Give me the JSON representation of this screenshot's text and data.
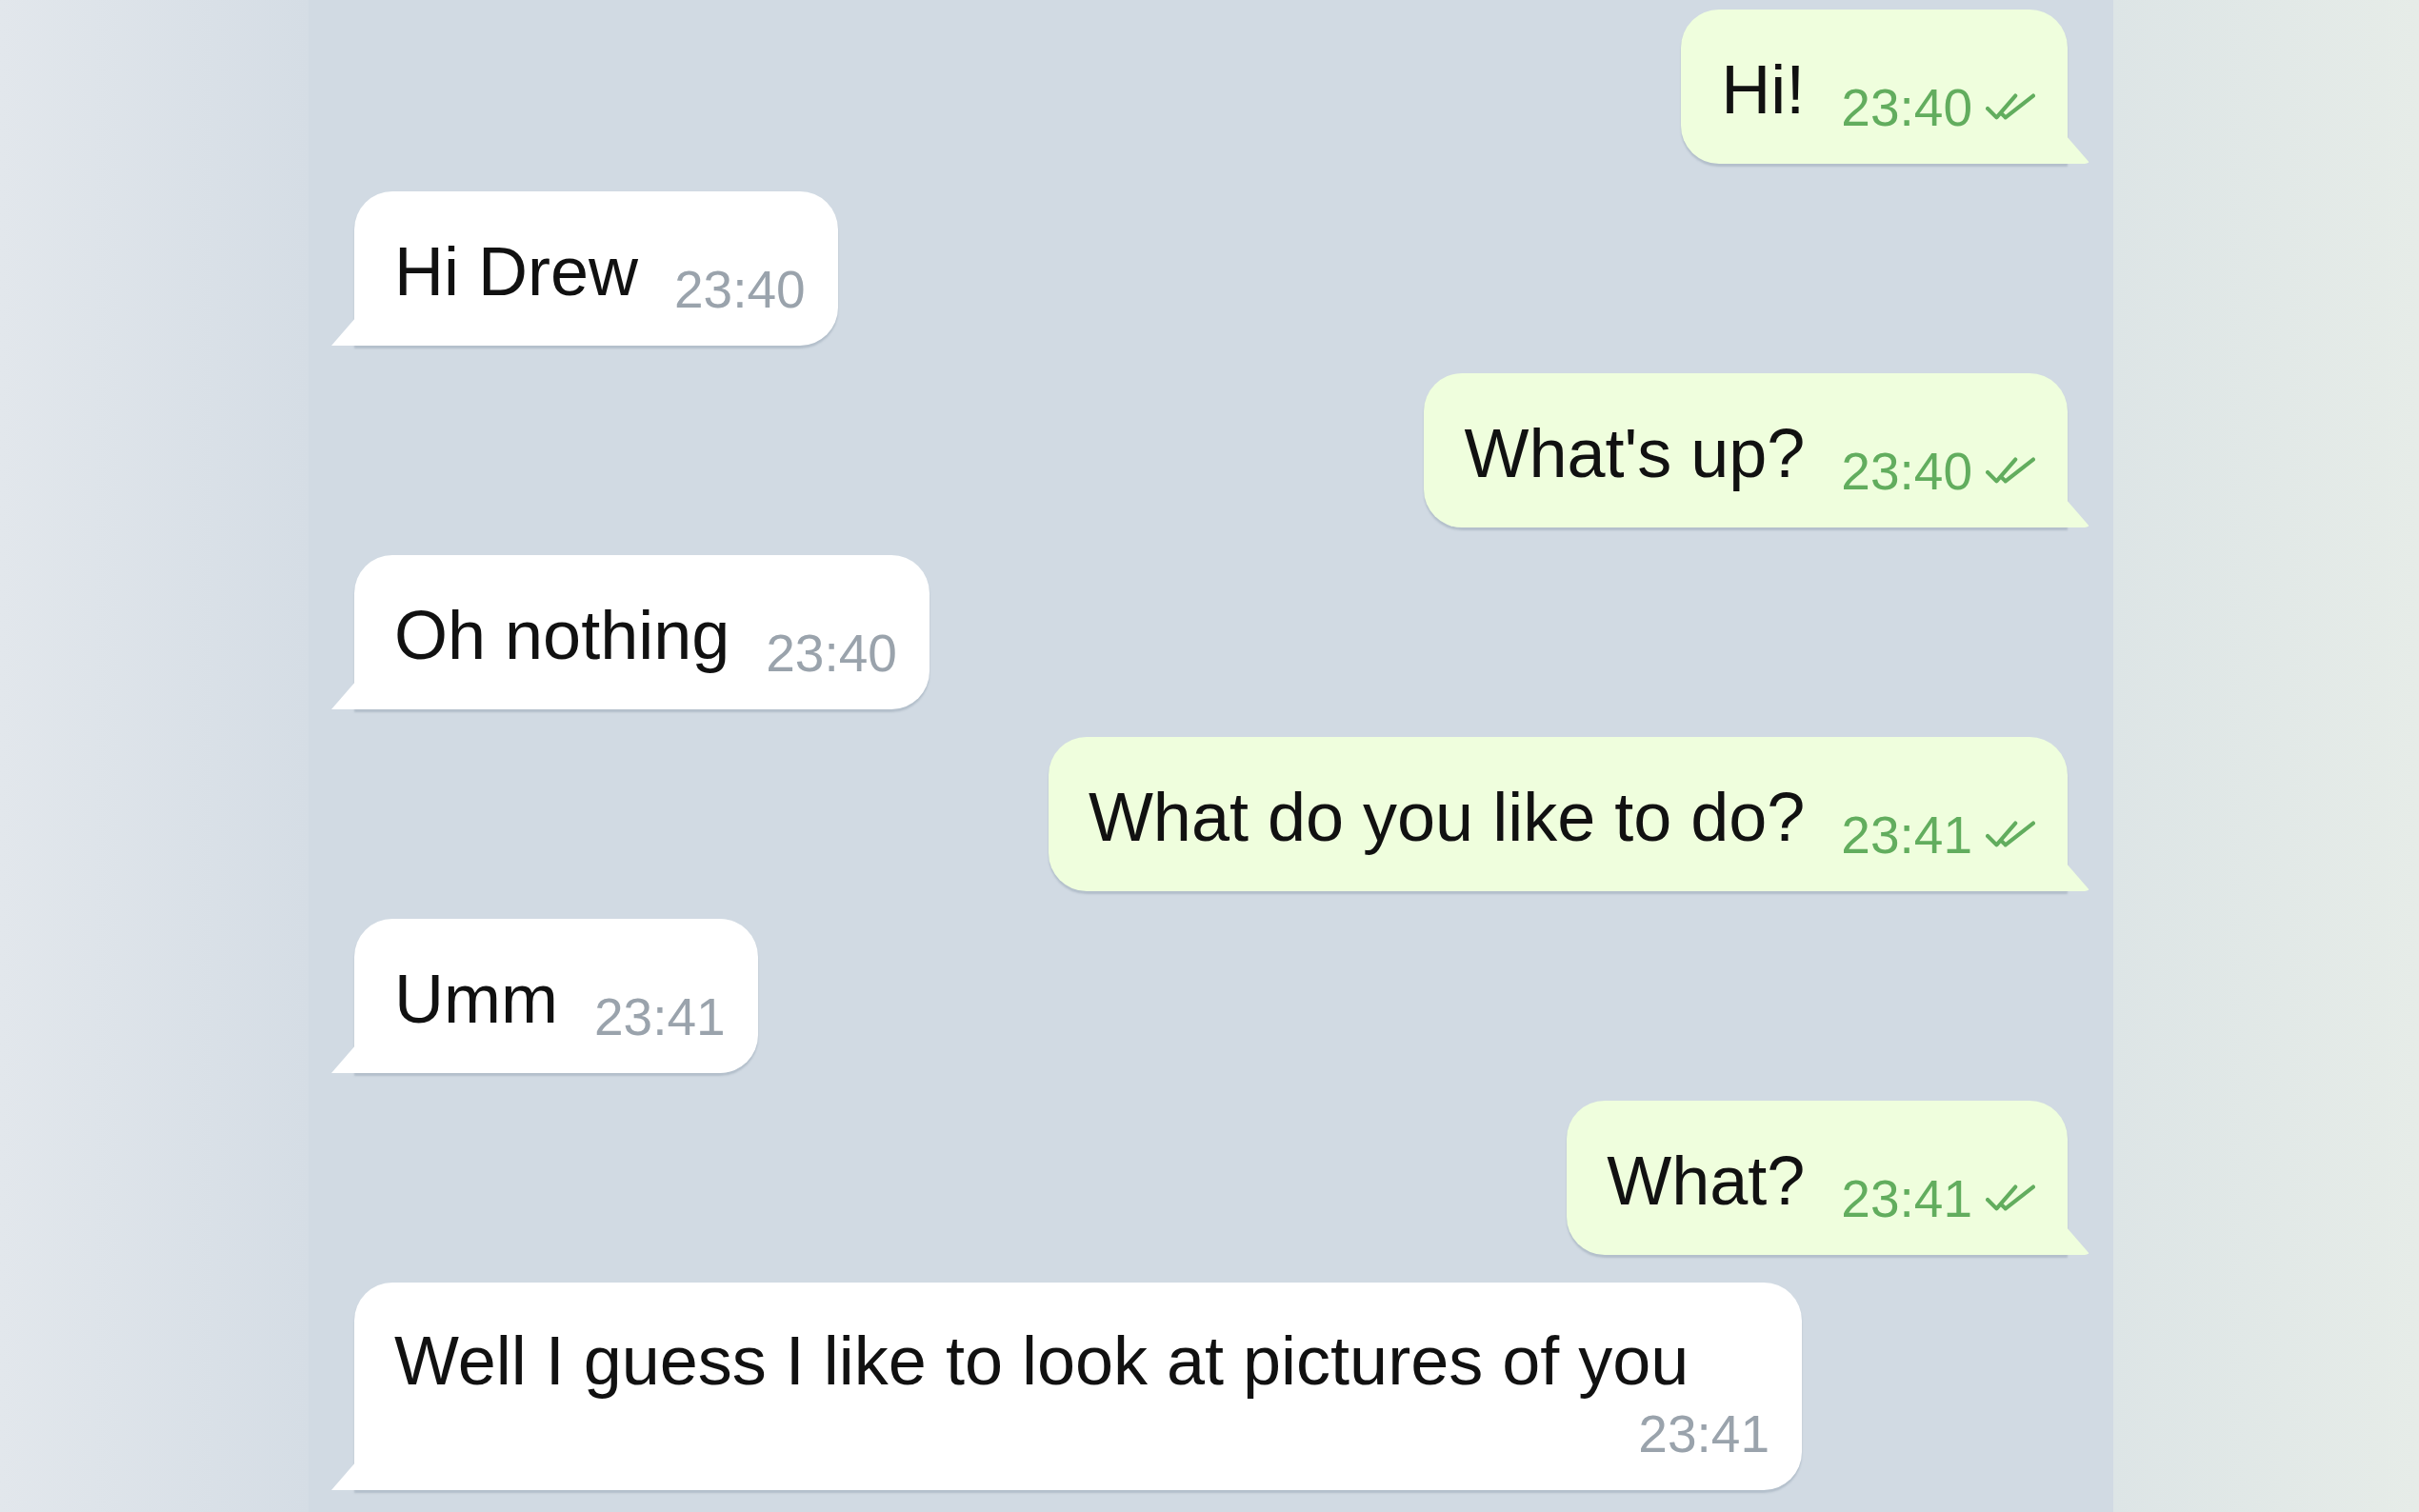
{
  "messages": [
    {
      "kind": "sent",
      "text": "Hi!",
      "time": "23:40",
      "read": true
    },
    {
      "kind": "received",
      "text": "Hi Drew",
      "time": "23:40"
    },
    {
      "kind": "sent",
      "text": "What's up?",
      "time": "23:40",
      "read": true
    },
    {
      "kind": "received",
      "text": "Oh nothing",
      "time": "23:40"
    },
    {
      "kind": "sent",
      "text": "What do you like to do?",
      "time": "23:41",
      "read": true
    },
    {
      "kind": "received",
      "text": "Umm",
      "time": "23:41"
    },
    {
      "kind": "sent",
      "text": "What?",
      "time": "23:41",
      "read": true
    },
    {
      "kind": "received",
      "text": "Well I guess I like to look at pictures of you",
      "time": "23:41"
    }
  ]
}
